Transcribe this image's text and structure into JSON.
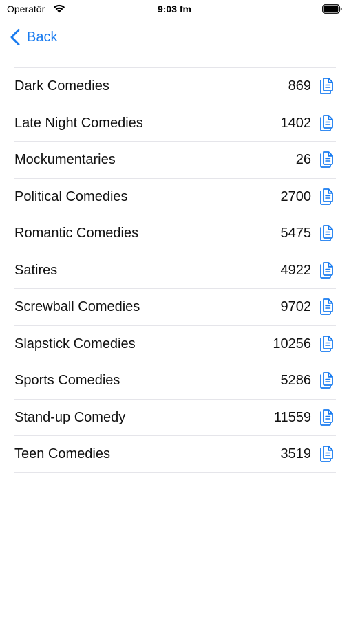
{
  "status_bar": {
    "carrier": "Operatör",
    "time": "9:03 fm",
    "wifi_icon": "wifi-icon",
    "battery_icon": "battery-full-icon"
  },
  "nav": {
    "back_label": "Back",
    "back_icon": "chevron-left-icon",
    "accent_color": "#1a7cf0"
  },
  "list": {
    "copy_icon": "copy-document-icon",
    "items": [
      {
        "title": "Dark Comedies",
        "count": "869"
      },
      {
        "title": "Late Night Comedies",
        "count": "1402"
      },
      {
        "title": "Mockumentaries",
        "count": "26"
      },
      {
        "title": "Political Comedies",
        "count": "2700"
      },
      {
        "title": "Romantic Comedies",
        "count": "5475"
      },
      {
        "title": "Satires",
        "count": "4922"
      },
      {
        "title": "Screwball Comedies",
        "count": "9702"
      },
      {
        "title": "Slapstick Comedies",
        "count": "10256"
      },
      {
        "title": "Sports Comedies",
        "count": "5286"
      },
      {
        "title": "Stand-up Comedy",
        "count": "11559"
      },
      {
        "title": "Teen Comedies",
        "count": "3519"
      }
    ]
  }
}
